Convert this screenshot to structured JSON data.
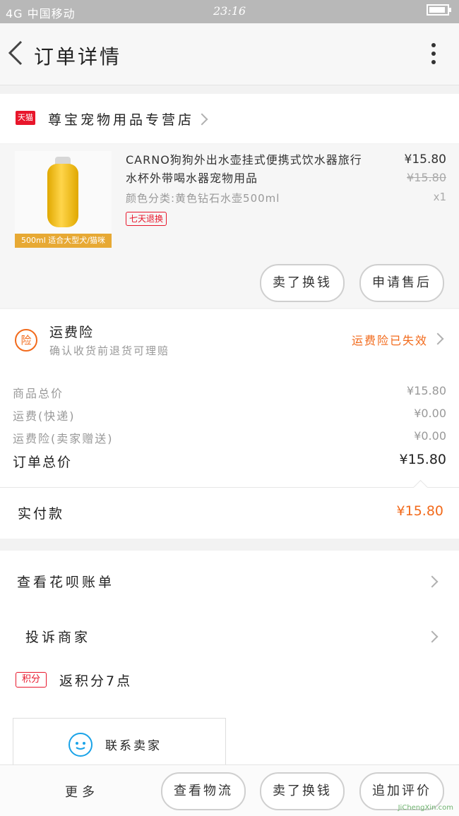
{
  "status_bar": {
    "left": "4G 中国移动",
    "time": "23:16"
  },
  "header": {
    "title": "订单详情"
  },
  "store": {
    "badge": "天猫",
    "name": "尊宝宠物用品专营店"
  },
  "product": {
    "title": "CARNO狗狗外出水壶挂式便携式饮水器旅行水杯外带喝水器宠物用品",
    "image_caption": "500ml 适合大型犬/猫咪",
    "spec": "颜色分类:黄色钻石水壶500ml",
    "tag": "七天退换",
    "price": "¥15.80",
    "original_price": "¥15.80",
    "qty": "x1",
    "buttons": [
      "卖了换钱",
      "申请售后"
    ]
  },
  "insurance": {
    "icon_text": "险",
    "title": "运费险",
    "subtitle": "确认收货前退货可理赔",
    "status": "运费险已失效"
  },
  "totals": [
    {
      "label": "商品总价",
      "value": "¥15.80"
    },
    {
      "label": "运费(快递)",
      "value": "¥0.00"
    },
    {
      "label": "运费险(卖家赠送)",
      "value": "¥0.00"
    },
    {
      "label": "订单总价",
      "value": "¥15.80"
    }
  ],
  "paid": {
    "label": "实付款",
    "value": "¥15.80"
  },
  "links": {
    "huabei": "查看花呗账单",
    "complain": "投诉商家",
    "points_badge": "积分",
    "points_text": "返积分7点",
    "contact": "联系卖家"
  },
  "bottom_bar": {
    "more": "更多",
    "logistics": "查看物流",
    "resell": "卖了换钱",
    "review": "追加评价"
  },
  "watermark": "JiChengXin.com",
  "colors": {
    "accent": "#f26a1b",
    "tmall_red": "#e8162b"
  }
}
